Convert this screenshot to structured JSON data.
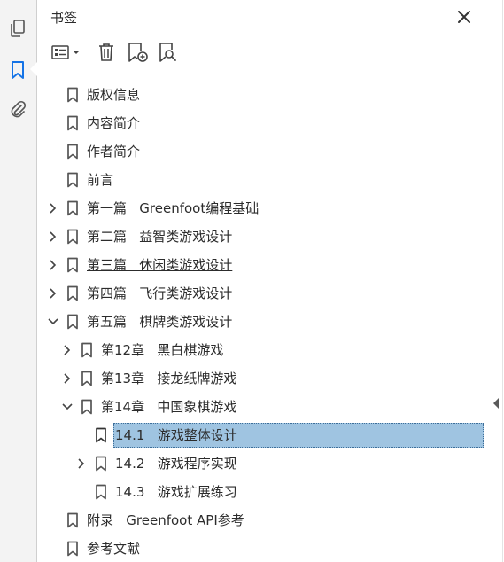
{
  "panel": {
    "title": "书签",
    "close_icon": "close-icon"
  },
  "rail": {
    "icons": [
      "pages-icon",
      "bookmark-icon",
      "attachment-icon"
    ],
    "active": "bookmark-icon",
    "accent": "#1473e6"
  },
  "toolbar": {
    "buttons": [
      "options-menu-icon",
      "delete-bookmark-icon",
      "new-bookmark-icon",
      "search-bookmark-icon"
    ]
  },
  "colors": {
    "selection": "#9fc4e1",
    "text": "#2c2c2c"
  },
  "bookmarks": [
    {
      "label": "版权信息",
      "level": 0,
      "expander": "none"
    },
    {
      "label": "内容简介",
      "level": 0,
      "expander": "none"
    },
    {
      "label": "作者简介",
      "level": 0,
      "expander": "none"
    },
    {
      "label": "前言",
      "level": 0,
      "expander": "none"
    },
    {
      "label": "第一篇   Greenfoot编程基础",
      "level": 0,
      "expander": "collapsed"
    },
    {
      "label": "第二篇   益智类游戏设计",
      "level": 0,
      "expander": "collapsed"
    },
    {
      "label": "第三篇   休闲类游戏设计",
      "level": 0,
      "expander": "collapsed",
      "hovered": true
    },
    {
      "label": "第四篇   飞行类游戏设计",
      "level": 0,
      "expander": "collapsed"
    },
    {
      "label": "第五篇   棋牌类游戏设计",
      "level": 0,
      "expander": "expanded"
    },
    {
      "label": "第12章   黑白棋游戏",
      "level": 1,
      "expander": "collapsed"
    },
    {
      "label": "第13章   接龙纸牌游戏",
      "level": 1,
      "expander": "collapsed"
    },
    {
      "label": "第14章   中国象棋游戏",
      "level": 1,
      "expander": "expanded"
    },
    {
      "label": "14.1   游戏整体设计",
      "level": 2,
      "expander": "none",
      "selected": true
    },
    {
      "label": "14.2   游戏程序实现",
      "level": 2,
      "expander": "collapsed"
    },
    {
      "label": "14.3   游戏扩展练习",
      "level": 2,
      "expander": "none"
    },
    {
      "label": "附录   Greenfoot API参考",
      "level": 0,
      "expander": "none"
    },
    {
      "label": "参考文献",
      "level": 0,
      "expander": "none"
    }
  ]
}
